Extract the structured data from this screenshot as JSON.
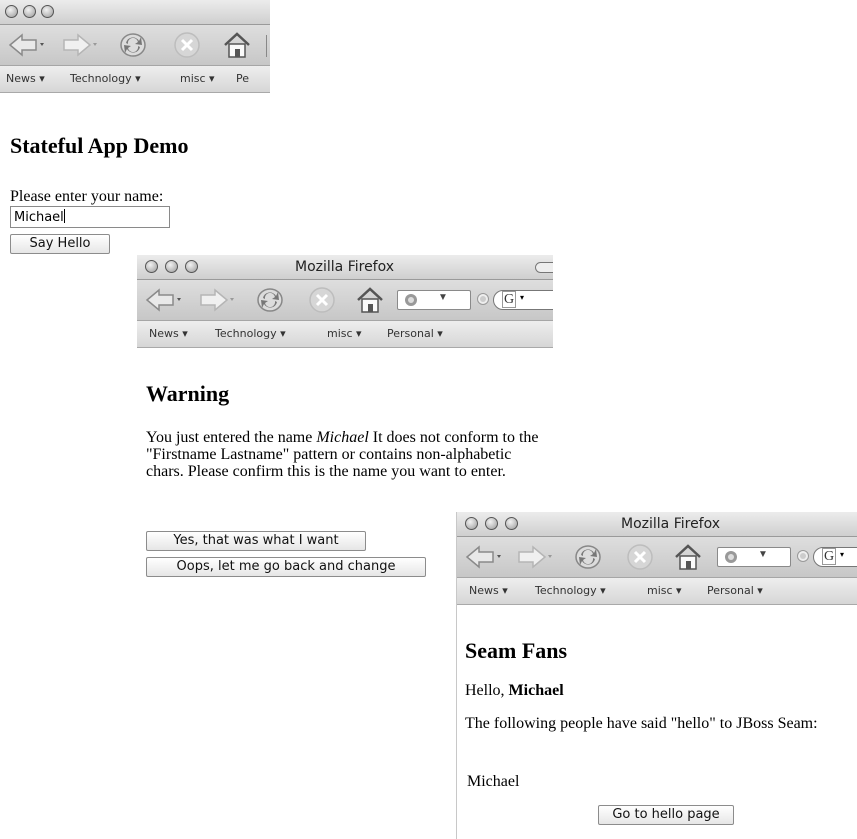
{
  "windows": {
    "one": {
      "title": "",
      "bookmarks": [
        "News ▾",
        "Technology ▾",
        "misc ▾",
        "Pe"
      ],
      "heading": "Stateful App Demo",
      "prompt": "Please enter your name:",
      "name_value": "Michael",
      "submit_label": "Say Hello"
    },
    "two": {
      "title": "Mozilla Firefox",
      "search_engine": "G",
      "bookmarks": [
        "News ▾",
        "Technology ▾",
        "misc ▾",
        "Personal ▾"
      ],
      "heading": "Warning",
      "message_before": "You just entered the name ",
      "message_name": "Michael",
      "message_after": " It does not conform to the \"Firstname Lastname\" pattern or contains non-alphabetic chars. Please confirm this is the name you want to enter.",
      "confirm_label": "Yes, that was what I want",
      "back_label": "Oops, let me go back and change"
    },
    "three": {
      "title": "Mozilla Firefox",
      "search_engine": "G",
      "bookmarks": [
        "News ▾",
        "Technology ▾",
        "misc ▾",
        "Personal ▾"
      ],
      "heading": "Seam Fans",
      "hello_prefix": "Hello, ",
      "hello_name": "Michael",
      "intro": "The following people have said \"hello\" to JBoss Seam:",
      "fans": [
        "Michael"
      ],
      "goto_label": "Go to hello page"
    }
  }
}
